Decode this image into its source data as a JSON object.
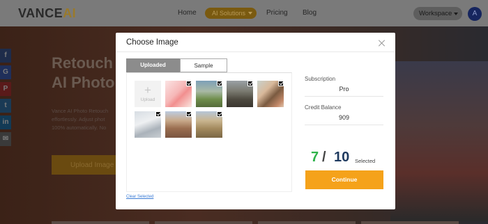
{
  "nav": {
    "logo_main": "VANCE",
    "logo_accent": "AI",
    "links": [
      "Home",
      "AI Solutions",
      "Pricing",
      "Blog"
    ],
    "workspace_label": "Workspace",
    "avatar_letter": "A"
  },
  "hero": {
    "title_line1": "Retouch",
    "title_line2": "AI Photo",
    "text_line1": "Vance AI Photo Retouch",
    "text_line2": "effortlessly. Adjust phot",
    "text_line3": "100% automatically. No",
    "button_label": "Upload Image"
  },
  "social": [
    "f",
    "G",
    "P",
    "t",
    "in",
    "✉"
  ],
  "modal": {
    "title": "Choose Image",
    "tabs": [
      "Uploaded",
      "Sample"
    ],
    "upload_tile_label": "Upload",
    "clear_link": "Clear Selected",
    "subscription_label": "Subscription",
    "subscription_value": "Pro",
    "credit_label": "Credit Balance",
    "credit_value": "909",
    "selected_count": "7",
    "slash": "/",
    "total_count": "10",
    "selected_label": "Selected",
    "continue_label": "Continue"
  },
  "colors": {
    "accent_orange": "#f5a21a",
    "selected_green": "#2fb34a",
    "total_navy": "#1f3a5f",
    "link_blue": "#3a7bd5"
  }
}
